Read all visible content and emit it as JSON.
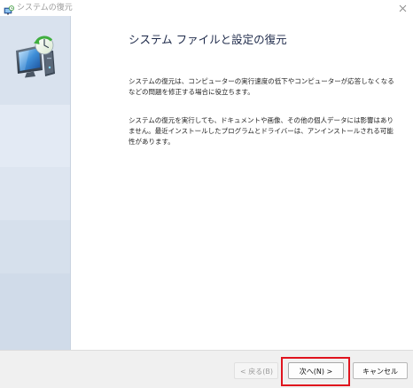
{
  "window": {
    "title": "システムの復元",
    "title_icon": "system-restore-icon",
    "close_icon": "close-icon"
  },
  "sidebar": {
    "art_icon": "system-restore-monitor-icon"
  },
  "main": {
    "heading": "システム ファイルと設定の復元",
    "paragraph1": "システムの復元は、コンピューターの実行速度の低下やコンピューターが応答しなくなるなどの問題を修正する場合に役立ちます。",
    "paragraph2": "システムの復元を実行しても、ドキュメントや画像、その他の個人データには影響はありません。最近インストールしたプログラムとドライバーは、アンインストールされる可能性があります。"
  },
  "footer": {
    "back_label": "< 戻る(B)",
    "back_enabled": false,
    "next_label": "次へ(N) >",
    "cancel_label": "キャンセル"
  },
  "colors": {
    "highlight": "#e0141e",
    "sidebar": "#d9e2ee",
    "heading": "#1e2a4a"
  }
}
